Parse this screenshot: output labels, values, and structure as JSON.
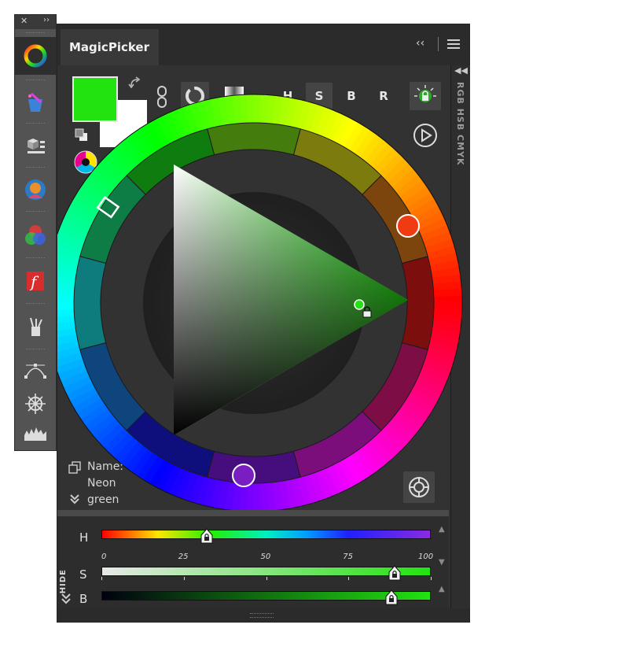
{
  "toolbar": {
    "close_label": "✕",
    "expand_label": "››",
    "items": [
      {
        "name": "magicpicker-wheel-icon",
        "active": true
      },
      {
        "name": "magic-hat-icon"
      },
      {
        "name": "cube-options-icon"
      },
      {
        "name": "portrait-icon"
      },
      {
        "name": "color-mix-icon"
      },
      {
        "name": "font-f-icon"
      },
      {
        "name": "brushes-icon"
      },
      {
        "name": "bezier-path-icon"
      },
      {
        "name": "ship-wheel-icon"
      },
      {
        "name": "histogram-icon"
      }
    ]
  },
  "panel": {
    "tab_label": "MagicPicker",
    "collapse_label": "‹‹",
    "menu_icon": "hamburger-menu-icon",
    "side_modes": "RGB HSB CMYK",
    "side_collapse": "◀◀"
  },
  "colors": {
    "foreground": "#22e310",
    "background": "#ffffff",
    "accent_orange": "#f03a12",
    "accent_purple": "#7a1ec2"
  },
  "mode_buttons": [
    {
      "label": "H",
      "selected": false
    },
    {
      "label": "S",
      "selected": true
    },
    {
      "label": "B",
      "selected": false
    },
    {
      "label": "R",
      "selected": false
    }
  ],
  "color_name": {
    "label": "Name:",
    "line1": "Neon",
    "line2": "green"
  },
  "sliders": {
    "h_label": "H",
    "s_label": "S",
    "b_label": "B",
    "hide_label": "HIDE",
    "scale_ticks": [
      "0",
      "25",
      "50",
      "75",
      "100"
    ],
    "h_value": 0.32,
    "s_value": 0.89,
    "b_value": 0.88
  }
}
